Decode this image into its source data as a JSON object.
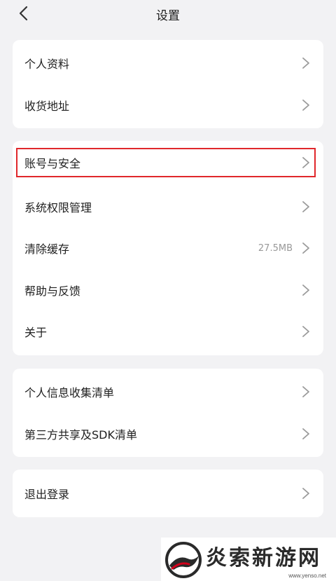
{
  "header": {
    "title": "设置"
  },
  "sections": [
    {
      "items": [
        {
          "label": "个人资料"
        },
        {
          "label": "收货地址"
        }
      ]
    },
    {
      "items": [
        {
          "label": "账号与安全",
          "highlighted": true
        },
        {
          "label": "系统权限管理"
        },
        {
          "label": "清除缓存",
          "value": "27.5MB"
        },
        {
          "label": "帮助与反馈"
        },
        {
          "label": "关于"
        }
      ]
    },
    {
      "items": [
        {
          "label": "个人信息收集清单"
        },
        {
          "label": "第三方共享及SDK清单"
        }
      ]
    },
    {
      "items": [
        {
          "label": "退出登录"
        }
      ]
    }
  ],
  "watermark": {
    "text": "炎索新游网",
    "url": "www.yenso.net"
  },
  "colors": {
    "background": "#f2f2f4",
    "card": "#ffffff",
    "highlight_border": "#e0272b",
    "chevron": "#9a9a9a",
    "secondary_text": "#999999"
  },
  "icons": {
    "back": "chevron-left-icon",
    "row_arrow": "chevron-right-icon"
  }
}
